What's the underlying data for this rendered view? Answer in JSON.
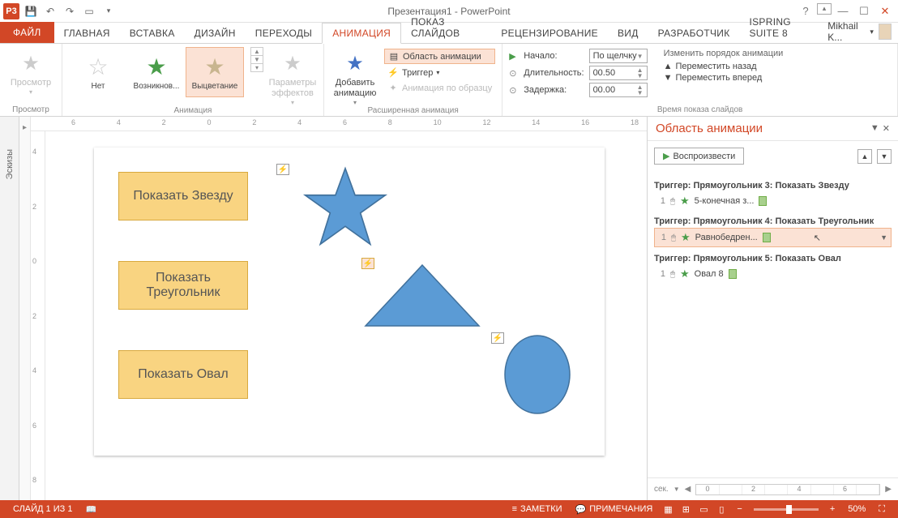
{
  "titlebar": {
    "title": "Презентация1 - PowerPoint",
    "appicon": "P3"
  },
  "tabs": {
    "file": "ФАЙЛ",
    "home": "ГЛАВНАЯ",
    "insert": "ВСТАВКА",
    "design": "ДИЗАЙН",
    "transitions": "ПЕРЕХОДЫ",
    "animation": "АНИМАЦИЯ",
    "slideshow": "ПОКАЗ СЛАЙДОВ",
    "review": "РЕЦЕНЗИРОВАНИЕ",
    "view": "ВИД",
    "developer": "РАЗРАБОТЧИК",
    "ispring": "ISPRING SUITE 8"
  },
  "user": {
    "name": "Mikhail K..."
  },
  "ribbon": {
    "preview_group": "Просмотр",
    "preview_btn": "Просмотр",
    "animation_group": "Анимация",
    "anim_none": "Нет",
    "anim_appear": "Возникнов...",
    "anim_fade": "Выцветание",
    "params_btn": "Параметры эффектов",
    "advanced_group": "Расширенная анимация",
    "add_anim": "Добавить анимацию",
    "anim_pane": "Область анимации",
    "trigger": "Триггер",
    "painter": "Анимация по образцу",
    "timing_group": "Время показа слайдов",
    "start_lbl": "Начало:",
    "start_val": "По щелчку",
    "duration_lbl": "Длительность:",
    "duration_val": "00.50",
    "delay_lbl": "Задержка:",
    "delay_val": "00.00",
    "reorder_title": "Изменить порядок анимации",
    "move_back": "Переместить назад",
    "move_fwd": "Переместить вперед"
  },
  "thumbs_label": "Эскизы",
  "slide": {
    "btn1": "Показать Звезду",
    "btn2": "Показать Треугольник",
    "btn3": "Показать Овал"
  },
  "pane": {
    "title": "Область анимации",
    "play": "Воспроизвести",
    "triggers": [
      {
        "label": "Триггер: Прямоугольник 3: Показать Звезду",
        "seq": "1",
        "name": "5-конечная з..."
      },
      {
        "label": "Триггер: Прямоугольник 4: Показать Треугольник",
        "seq": "1",
        "name": "Равнобедрен..."
      },
      {
        "label": "Триггер: Прямоугольник 5: Показать Овал",
        "seq": "1",
        "name": "Овал 8"
      }
    ],
    "sec_label": "сек.",
    "ticks": [
      "0",
      "2",
      "4",
      "6"
    ]
  },
  "statusbar": {
    "slide_info": "СЛАЙД 1 ИЗ 1",
    "notes": "ЗАМЕТКИ",
    "comments": "ПРИМЕЧАНИЯ",
    "zoom": "50%"
  },
  "ruler": {
    "h": [
      "6",
      "4",
      "2",
      "0",
      "2",
      "4",
      "6",
      "8",
      "10",
      "12",
      "14",
      "16",
      "18"
    ],
    "v": [
      "4",
      "2",
      "0",
      "2",
      "4",
      "6",
      "8"
    ]
  }
}
